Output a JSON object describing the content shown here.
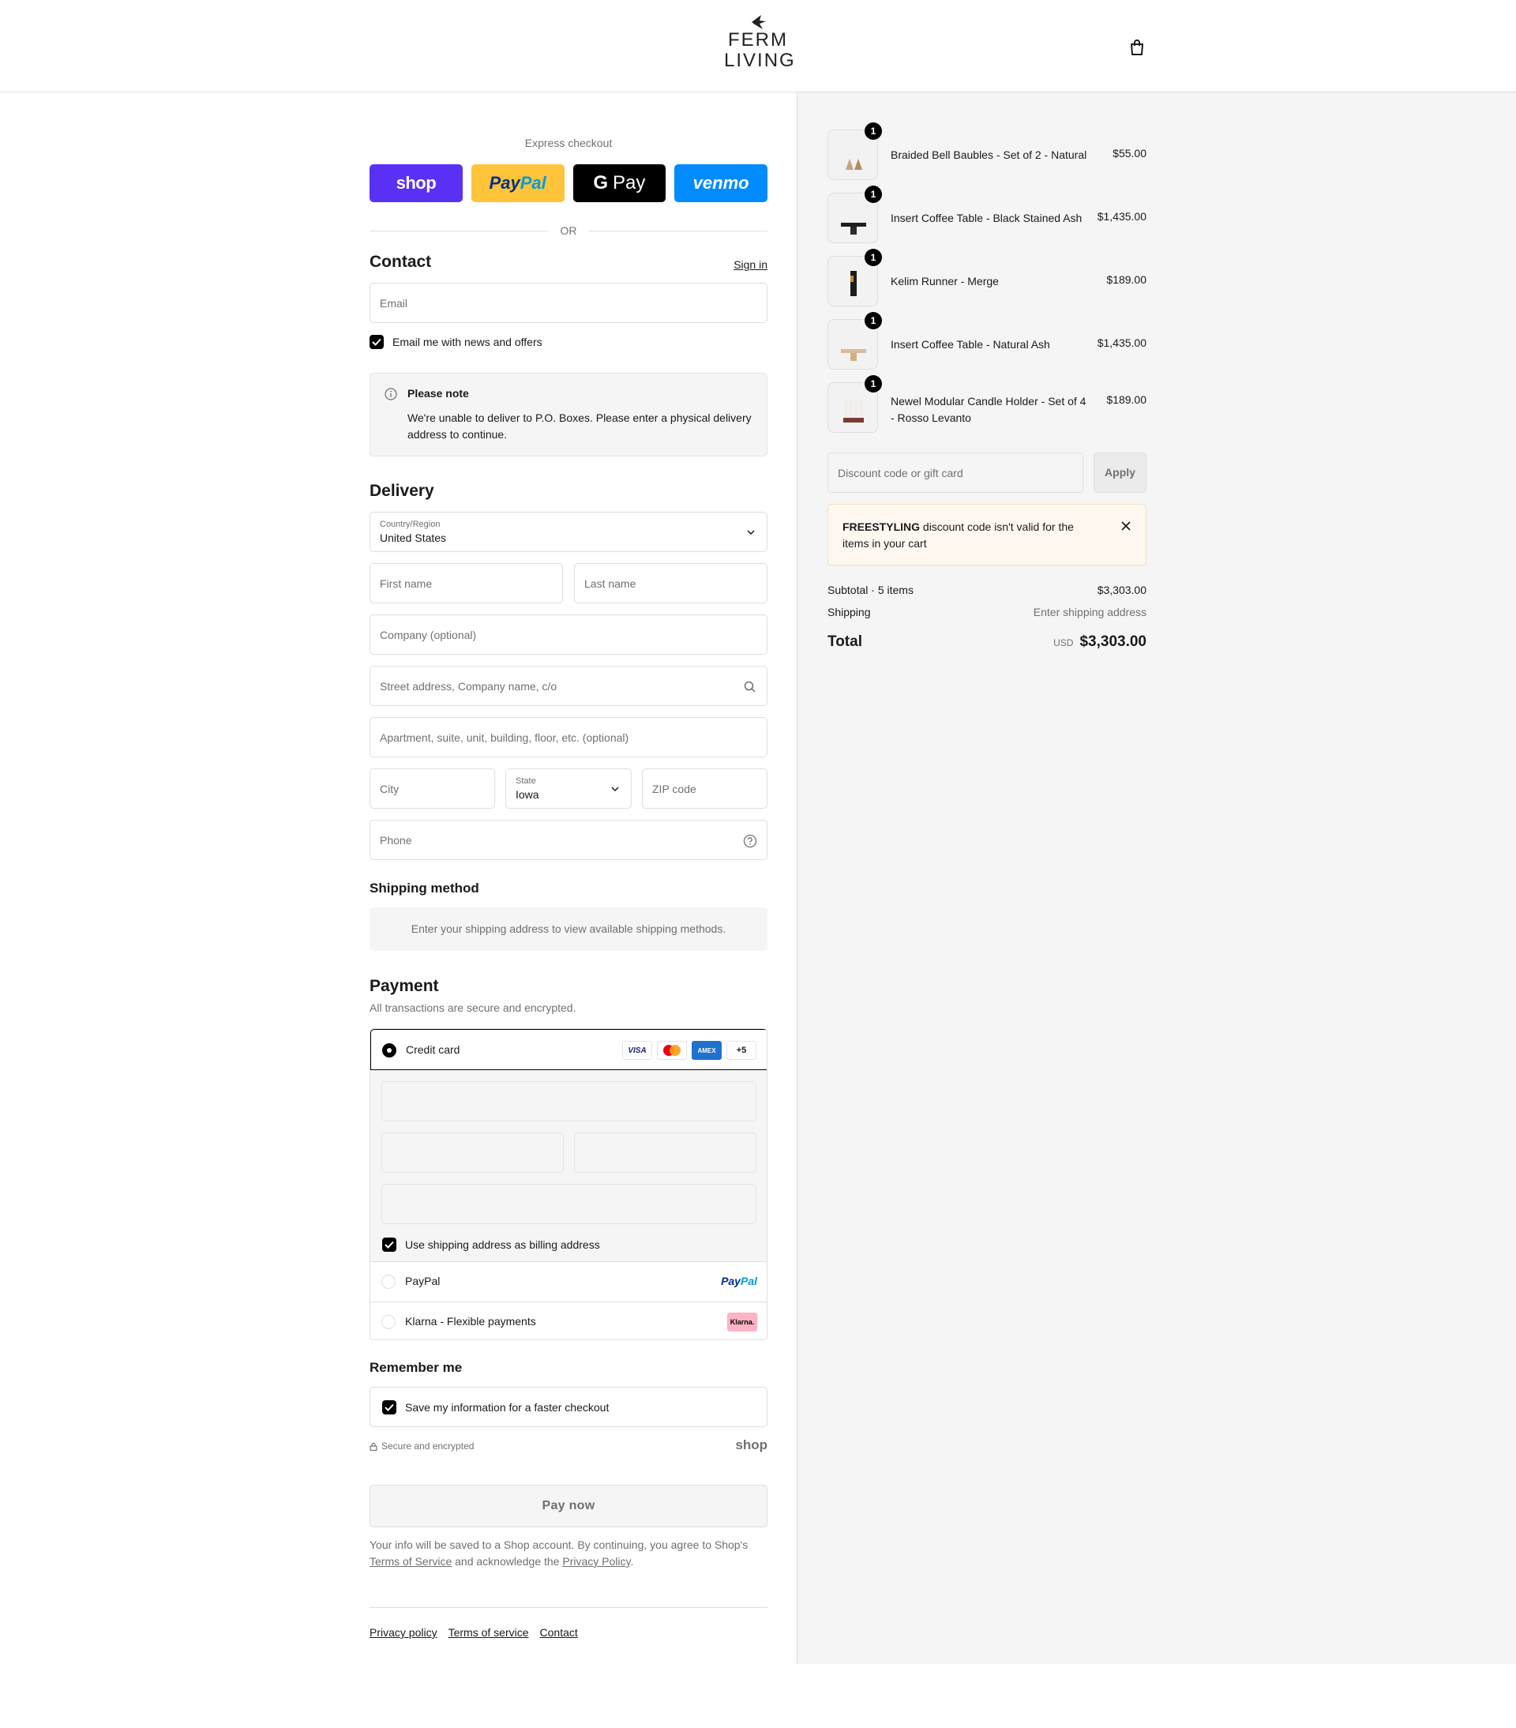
{
  "header": {
    "logo_line1": "FERM",
    "logo_line2": "LIVING"
  },
  "express": {
    "label": "Express checkout",
    "shop": "shop",
    "paypal_a": "Pay",
    "paypal_b": "Pal",
    "gpay_g": "G",
    "gpay": "Pay",
    "venmo": "venmo",
    "or": "OR"
  },
  "contact": {
    "title": "Contact",
    "sign_in": "Sign in",
    "email_placeholder": "Email",
    "news_checkbox": "Email me with news and offers",
    "news_checked": true
  },
  "note": {
    "title": "Please note",
    "body": "We're unable to deliver to P.O. Boxes. Please enter a physical delivery address to continue."
  },
  "delivery": {
    "title": "Delivery",
    "country_label": "Country/Region",
    "country_value": "United States",
    "first_name": "First name",
    "last_name": "Last name",
    "company": "Company (optional)",
    "street": "Street address, Company name, c/o",
    "apartment": "Apartment, suite, unit, building, floor, etc. (optional)",
    "city": "City",
    "state_label": "State",
    "state_value": "Iowa",
    "zip": "ZIP code",
    "phone": "Phone"
  },
  "shipping": {
    "title": "Shipping method",
    "info": "Enter your shipping address to view available shipping methods."
  },
  "payment": {
    "title": "Payment",
    "subtitle": "All transactions are secure and encrypted.",
    "credit_card": "Credit card",
    "card_visa": "VISA",
    "card_amex": "AMEX",
    "card_more": "+5",
    "billing_checkbox": "Use shipping address as billing address",
    "paypal": "PayPal",
    "paypal_logo_a": "Pay",
    "paypal_logo_b": "Pal",
    "klarna": "Klarna - Flexible payments",
    "klarna_logo": "Klarna."
  },
  "remember": {
    "title": "Remember me",
    "checkbox": "Save my information for a faster checkout",
    "secure": "Secure and encrypted",
    "shop": "shop"
  },
  "pay_now": "Pay now",
  "legal": {
    "part1": "Your info will be saved to a Shop account. By continuing, you agree to Shop's ",
    "tos": "Terms of Service",
    "part2": " and acknowledge the ",
    "privacy": "Privacy Policy",
    "part3": "."
  },
  "footer": {
    "privacy": "Privacy policy",
    "terms": "Terms of service",
    "contact": "Contact"
  },
  "cart": {
    "items": [
      {
        "qty": "1",
        "name": "Braided Bell Baubles - Set of 2 - Natural",
        "price": "$55.00"
      },
      {
        "qty": "1",
        "name": "Insert Coffee Table - Black Stained Ash",
        "price": "$1,435.00"
      },
      {
        "qty": "1",
        "name": "Kelim Runner - Merge",
        "price": "$189.00"
      },
      {
        "qty": "1",
        "name": "Insert Coffee Table - Natural Ash",
        "price": "$1,435.00"
      },
      {
        "qty": "1",
        "name": "Newel Modular Candle Holder - Set of 4 - Rosso Levanto",
        "price": "$189.00"
      }
    ],
    "discount_placeholder": "Discount code or gift card",
    "apply": "Apply",
    "error_code": "FREESTYLING",
    "error_msg": " discount code isn't valid for the items in your cart",
    "subtotal_label": "Subtotal · 5 items",
    "subtotal_value": "$3,303.00",
    "shipping_label": "Shipping",
    "shipping_value": "Enter shipping address",
    "total_label": "Total",
    "currency": "USD",
    "total_value": "$3,303.00"
  },
  "colors": {
    "shop_purple": "#5a31f4",
    "paypal_yellow": "#ffc439",
    "venmo_blue": "#008cff",
    "right_panel_bg": "#f5f5f5"
  }
}
